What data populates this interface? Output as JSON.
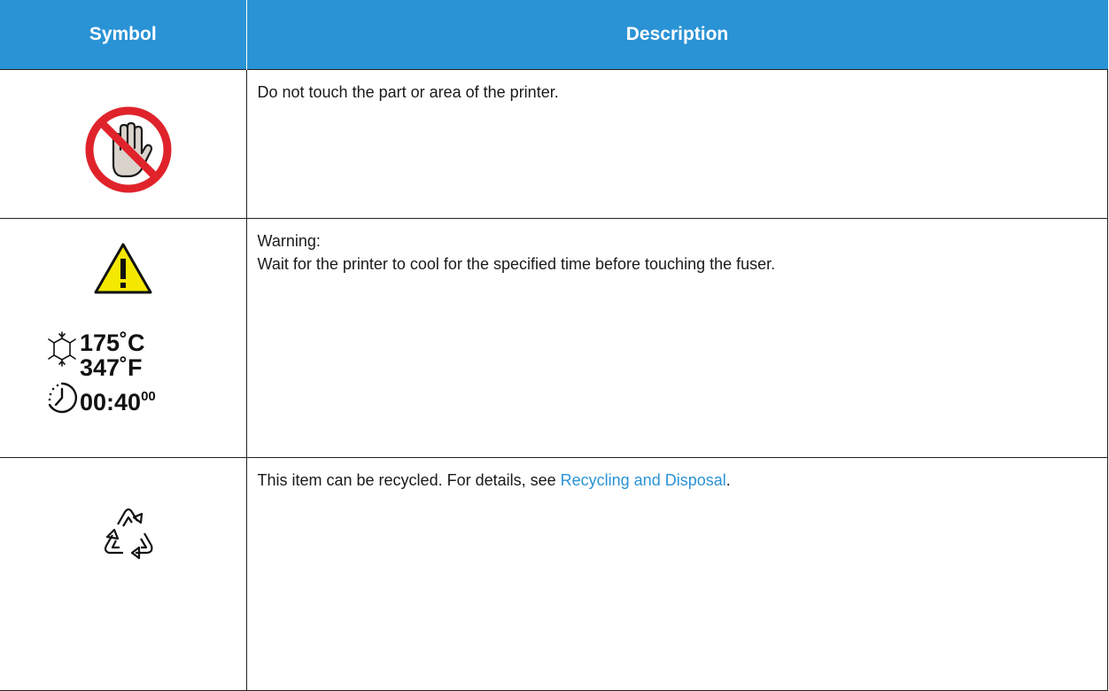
{
  "table": {
    "header_symbol": "Symbol",
    "header_description": "Description"
  },
  "rows": [
    {
      "icon": "no-touch-icon",
      "description": "Do not touch the part or area of the printer."
    },
    {
      "icons": [
        "warning-triangle-icon",
        "cooling-snowflake-icon",
        "timer-clock-icon"
      ],
      "warning_label": "Warning:",
      "description": "Wait for the printer to cool for the specified time before touching the fuser.",
      "fuser_celsius": "175˚C",
      "fuser_fahrenheit": "347˚F",
      "cooldown_time": "00:40",
      "cooldown_time_sup": "00"
    },
    {
      "icon": "recycle-icon",
      "description_prefix": "This item can be recycled. For details, see ",
      "link_text": "Recycling and Disposal",
      "description_suffix": "."
    }
  ],
  "colors": {
    "header_bg": "#2a93d5",
    "link": "#2a93d5",
    "prohibition_red": "#e0232b",
    "warning_yellow": "#f5e800"
  }
}
